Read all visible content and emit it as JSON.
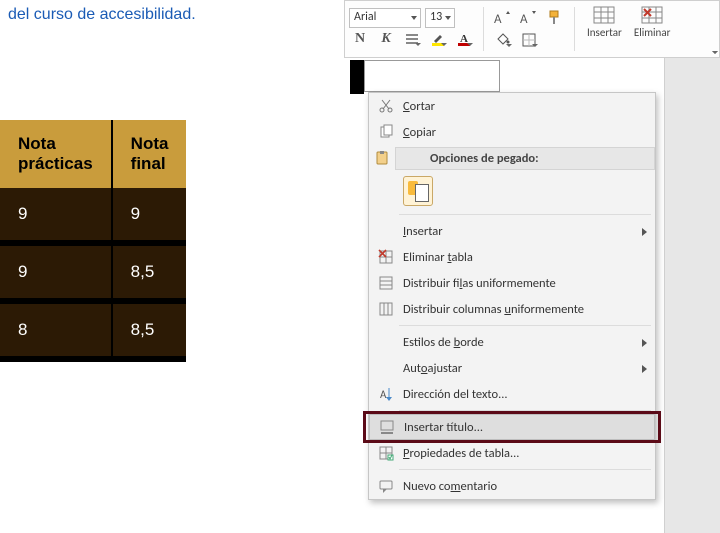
{
  "doc": {
    "visible_text": "del curso de accesibilidad",
    "trailing_dot": "."
  },
  "table": {
    "headers": [
      "Nota prácticas",
      "Nota final"
    ],
    "rows": [
      [
        "9",
        "9"
      ],
      [
        "9",
        "8,5"
      ],
      [
        "8",
        "8,5"
      ]
    ]
  },
  "mini_toolbar": {
    "font_name": "Arial",
    "font_size": "13",
    "bold": "N",
    "italic": "K",
    "insert_label": "Insertar",
    "delete_label": "Eliminar"
  },
  "context_menu": {
    "items": [
      {
        "id": "cut",
        "label": "Cortar",
        "ul": "C",
        "rest": "ortar"
      },
      {
        "id": "copy",
        "label": "Copiar",
        "ul": "C",
        "rest": "opiar"
      },
      {
        "id": "paste-options-heading",
        "label": "Opciones de pegado:"
      },
      {
        "id": "paste-preview"
      },
      {
        "id": "insert",
        "label": "Insertar",
        "ul": "I",
        "rest": "nsertar",
        "submenu": true
      },
      {
        "id": "delete-table",
        "label": "Eliminar tabla",
        "ul": "t",
        "pre": "Eliminar ",
        "rest": "abla"
      },
      {
        "id": "distribute-rows",
        "label": "Distribuir filas uniformemente",
        "ul": "l",
        "pre": "Distribuir fi",
        "rest": "as uniformemente"
      },
      {
        "id": "distribute-cols",
        "label": "Distribuir columnas uniformemente",
        "ul": "u",
        "pre": "Distribuir columnas ",
        "rest": "niformemente"
      },
      {
        "id": "border-styles",
        "label": "Estilos de borde",
        "ul": "b",
        "pre": "Estilos de ",
        "rest": "orde",
        "submenu": true
      },
      {
        "id": "autofit",
        "label": "Autoajustar",
        "ul": "o",
        "pre": "Aut",
        "rest": "ajustar",
        "submenu": true
      },
      {
        "id": "text-direction",
        "label": "Dirección del texto..."
      },
      {
        "id": "insert-caption",
        "label": "Insertar título...",
        "highlight": true
      },
      {
        "id": "table-properties",
        "label": "Propiedades de tabla...",
        "ul": "P",
        "rest": "ropiedades de tabla..."
      },
      {
        "id": "new-comment",
        "label": "Nuevo comentario",
        "ul": "m",
        "pre": "Nuevo co",
        "rest": "entario"
      }
    ]
  }
}
